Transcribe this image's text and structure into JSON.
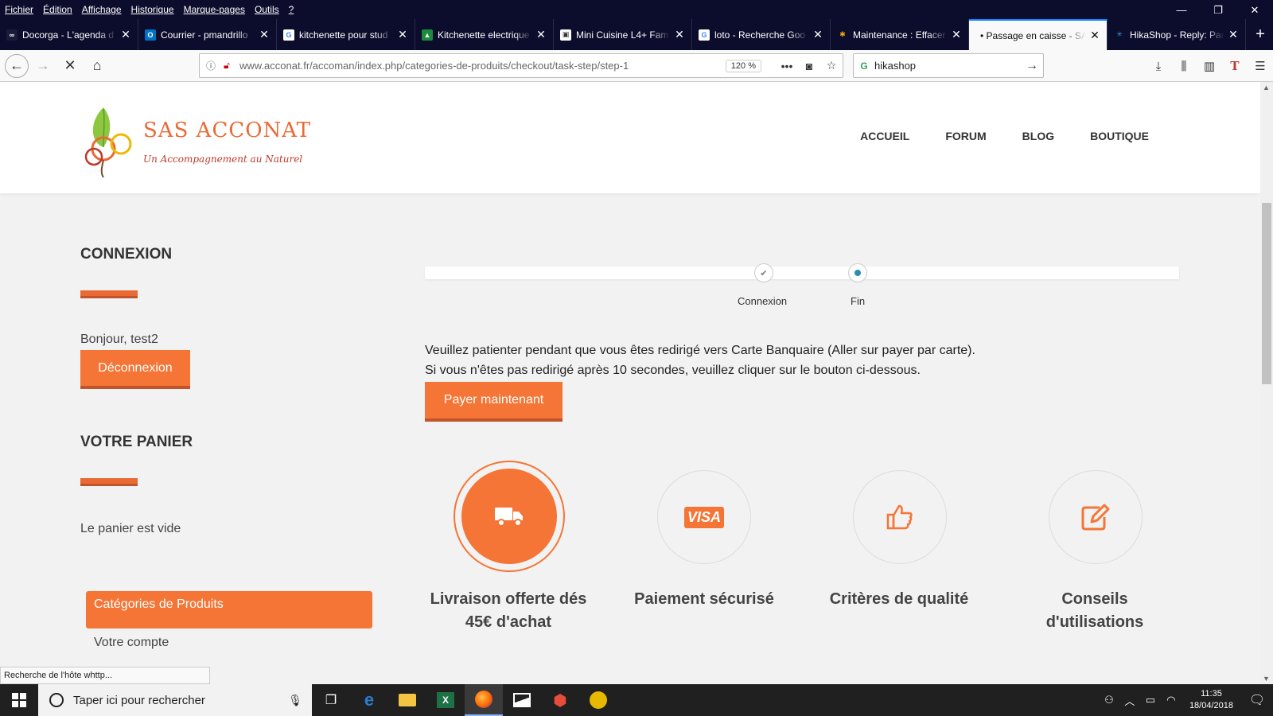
{
  "menubar": {
    "items": [
      "Fichier",
      "Édition",
      "Affichage",
      "Historique",
      "Marque-pages",
      "Outils",
      "?"
    ]
  },
  "window": {
    "minimize": "—",
    "restore": "❐",
    "close": "✕"
  },
  "tabs": [
    {
      "title": "Docorga - L'agenda d",
      "fav": "∞",
      "favColor": "#ffffff",
      "favBg": "#1a1a3a"
    },
    {
      "title": "Courrier - pmandrillo",
      "fav": "O",
      "favColor": "#ffffff",
      "favBg": "#0072c6"
    },
    {
      "title": "kitchenette pour stud",
      "fav": "G",
      "favColor": "#4285f4",
      "favBg": "#ffffff"
    },
    {
      "title": "Kitchenette electrique",
      "fav": "▲",
      "favColor": "#ffffff",
      "favBg": "#1e8a3c"
    },
    {
      "title": "Mini Cuisine L4+ Fam",
      "fav": "▣",
      "favColor": "#333333",
      "favBg": "#ffffff"
    },
    {
      "title": "loto - Recherche Goo",
      "fav": "G",
      "favColor": "#4285f4",
      "favBg": "#ffffff"
    },
    {
      "title": "Maintenance : Effacer",
      "fav": "✱",
      "favColor": "#f4a60d",
      "favBg": "#0c0c2c"
    },
    {
      "title": "• Passage en caisse - SA",
      "fav": "",
      "favColor": "#000000",
      "favBg": "transparent",
      "active": true
    },
    {
      "title": "HikaShop - Reply: Par",
      "fav": "✳",
      "favColor": "#2a9fd6",
      "favBg": "#0c0c2c"
    }
  ],
  "newtab": "+",
  "nav": {
    "url": "www.acconat.fr/accoman/index.php/categories-de-produits/checkout/task-step/step-1",
    "zoom": "120 %",
    "search": "hikashop"
  },
  "site": {
    "brand": "SAS ACCONAT",
    "tagline": "Un Accompagnement au Naturel",
    "menu": [
      "ACCUEIL",
      "FORUM",
      "BLOG",
      "BOUTIQUE"
    ]
  },
  "sidebar": {
    "login_title": "CONNEXION",
    "greeting": "Bonjour, test2",
    "logout": "Déconnexion",
    "cart_title": "VOTRE PANIER",
    "cart_empty": "Le panier est vide",
    "categories": "Catégories de Produits",
    "account": "Votre compte"
  },
  "steps": [
    {
      "label": "Connexion",
      "state": "done"
    },
    {
      "label": "Fin",
      "state": "current"
    }
  ],
  "checkout": {
    "line1": "Veuillez patienter pendant que vous êtes redirigé vers Carte Banquaire (Aller sur payer par carte).",
    "line2": "Si vous n'êtes pas redirigé après 10 secondes, veuillez cliquer sur le bouton ci-dessous.",
    "pay_button": "Payer maintenant"
  },
  "features": [
    {
      "line1": "Livraison offerte dés",
      "line2": "45€ d'achat",
      "icon": "truck-icon"
    },
    {
      "line1": "Paiement sécurisé",
      "line2": "",
      "icon": "visa-icon",
      "icon_text": "VISA"
    },
    {
      "line1": "Critères de qualité",
      "line2": "",
      "icon": "thumbs-up-icon"
    },
    {
      "line1": "Conseils",
      "line2": "d'utilisations",
      "icon": "edit-icon"
    }
  ],
  "status": "Recherche de l'hôte whttp...",
  "taskbar": {
    "search_placeholder": "Taper ici pour rechercher",
    "time": "11:35",
    "date": "18/04/2018"
  },
  "colors": {
    "accent": "#f47535",
    "accent_dark": "#c2542b",
    "step_blue": "#2a8bb3"
  }
}
